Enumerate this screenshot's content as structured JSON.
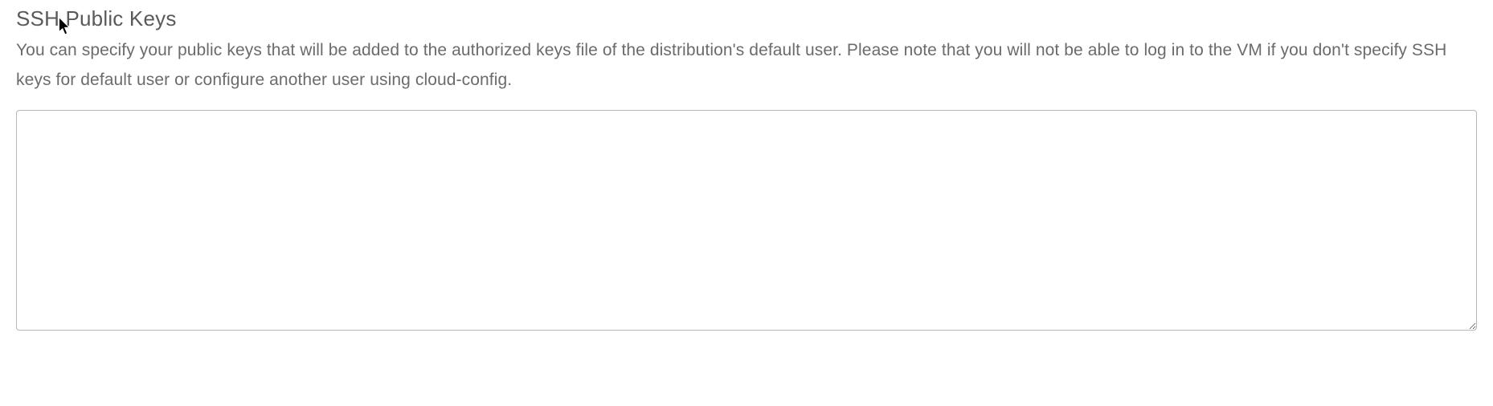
{
  "section": {
    "heading": "SSH Public Keys",
    "description": "You can specify your public keys that will be added to the authorized keys file of the distribution's default user. Please note that you will not be able to log in to the VM if you don't specify SSH keys for default user or configure another user using cloud-config."
  },
  "form": {
    "ssh_keys_value": ""
  }
}
